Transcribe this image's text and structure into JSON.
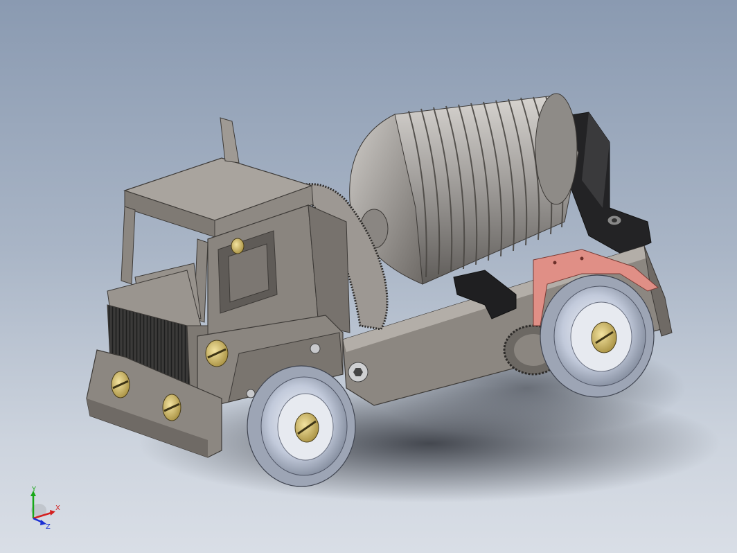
{
  "viewport": {
    "background_top": "#8a9ab1",
    "background_bottom": "#d9dee6",
    "model": "concrete-mixer-truck-assembly"
  },
  "triad": {
    "x_label": "X",
    "y_label": "Y",
    "z_label": "Z",
    "x_color": "#d42020",
    "y_color": "#18a818",
    "z_color": "#1a2fd4"
  },
  "colors": {
    "body_gray": "#8f8a84",
    "drum_silver": "#a9a8a6",
    "brass": "#c9b46a",
    "wheel_rim": "#c9d2e2",
    "fender_pink": "#e08f86",
    "bracket_black": "#232325"
  }
}
